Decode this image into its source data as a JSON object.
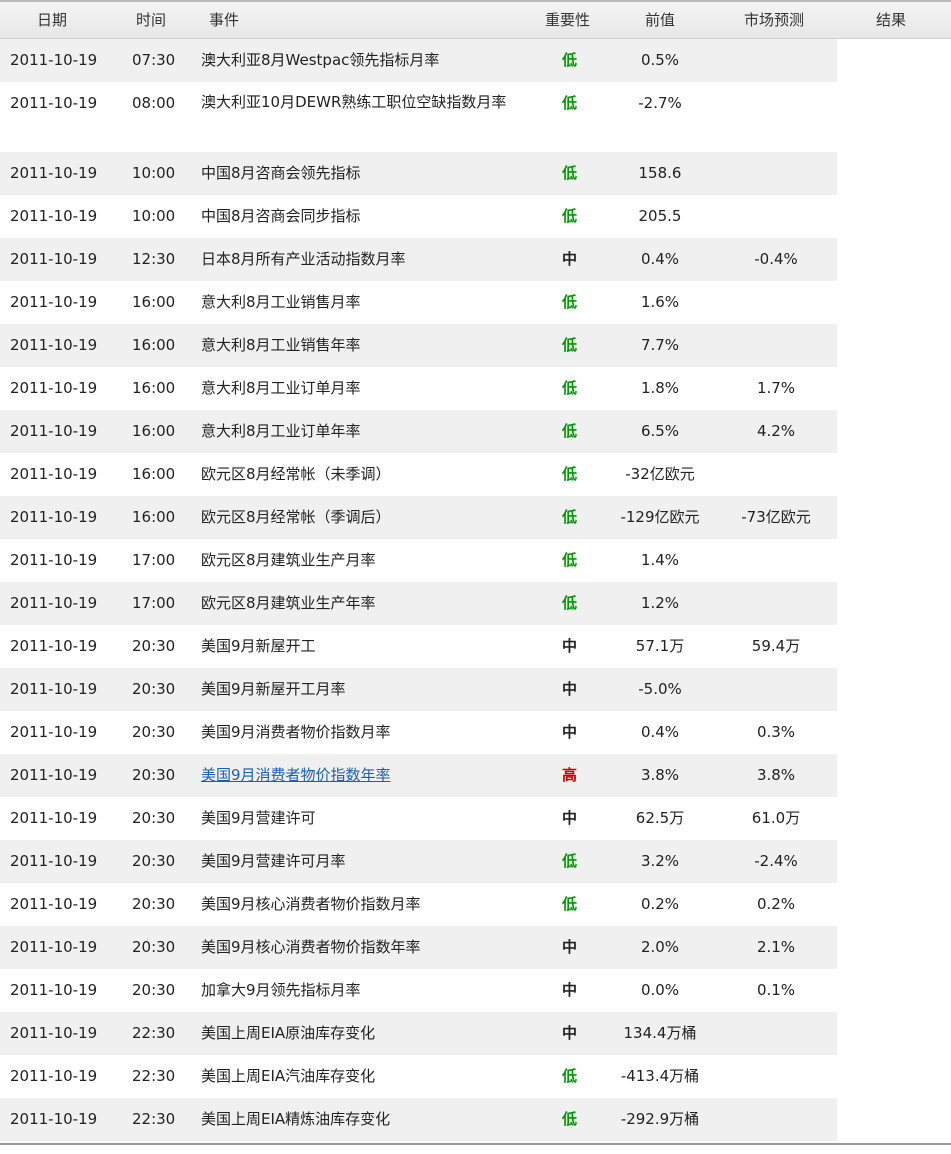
{
  "header": {
    "date": "日期",
    "time": "时间",
    "event": "事件",
    "importance": "重要性",
    "previous": "前值",
    "forecast": "市场预测",
    "result": "结果"
  },
  "colors": {
    "low": "#009900",
    "medium": "#000099",
    "high": "#cc0000",
    "row_alt": "#f0f0f0",
    "link": "#1a5fb4"
  },
  "rows": [
    {
      "date": "2011-10-19",
      "time": "07:30",
      "event": "澳大利亚8月Westpac领先指标月率",
      "importance": "低",
      "level": "low",
      "previous": "0.5%",
      "forecast": "",
      "result": ""
    },
    {
      "date": "2011-10-19",
      "time": "08:00",
      "event": "澳大利亚10月DEWR熟练工职位空缺指数月率",
      "importance": "低",
      "level": "low",
      "previous": "-2.7%",
      "forecast": "",
      "result": ""
    },
    {
      "date": "2011-10-19",
      "time": "10:00",
      "event": "中国8月咨商会领先指标",
      "importance": "低",
      "level": "low",
      "previous": "158.6",
      "forecast": "",
      "result": ""
    },
    {
      "date": "2011-10-19",
      "time": "10:00",
      "event": "中国8月咨商会同步指标",
      "importance": "低",
      "level": "low",
      "previous": "205.5",
      "forecast": "",
      "result": ""
    },
    {
      "date": "2011-10-19",
      "time": "12:30",
      "event": "日本8月所有产业活动指数月率",
      "importance": "中",
      "level": "medium",
      "previous": "0.4%",
      "forecast": "-0.4%",
      "result": ""
    },
    {
      "date": "2011-10-19",
      "time": "16:00",
      "event": "意大利8月工业销售月率",
      "importance": "低",
      "level": "low",
      "previous": "1.6%",
      "forecast": "",
      "result": ""
    },
    {
      "date": "2011-10-19",
      "time": "16:00",
      "event": "意大利8月工业销售年率",
      "importance": "低",
      "level": "low",
      "previous": "7.7%",
      "forecast": "",
      "result": ""
    },
    {
      "date": "2011-10-19",
      "time": "16:00",
      "event": "意大利8月工业订单月率",
      "importance": "低",
      "level": "low",
      "previous": "1.8%",
      "forecast": "1.7%",
      "result": ""
    },
    {
      "date": "2011-10-19",
      "time": "16:00",
      "event": "意大利8月工业订单年率",
      "importance": "低",
      "level": "low",
      "previous": "6.5%",
      "forecast": "4.2%",
      "result": ""
    },
    {
      "date": "2011-10-19",
      "time": "16:00",
      "event": "欧元区8月经常帐（未季调）",
      "importance": "低",
      "level": "low",
      "previous": "-32亿欧元",
      "forecast": "",
      "result": ""
    },
    {
      "date": "2011-10-19",
      "time": "16:00",
      "event": "欧元区8月经常帐（季调后）",
      "importance": "低",
      "level": "low",
      "previous": "-129亿欧元",
      "forecast": "-73亿欧元",
      "result": ""
    },
    {
      "date": "2011-10-19",
      "time": "17:00",
      "event": "欧元区8月建筑业生产月率",
      "importance": "低",
      "level": "low",
      "previous": "1.4%",
      "forecast": "",
      "result": ""
    },
    {
      "date": "2011-10-19",
      "time": "17:00",
      "event": "欧元区8月建筑业生产年率",
      "importance": "低",
      "level": "low",
      "previous": "1.2%",
      "forecast": "",
      "result": ""
    },
    {
      "date": "2011-10-19",
      "time": "20:30",
      "event": "美国9月新屋开工",
      "importance": "中",
      "level": "medium",
      "previous": "57.1万",
      "forecast": "59.4万",
      "result": ""
    },
    {
      "date": "2011-10-19",
      "time": "20:30",
      "event": "美国9月新屋开工月率",
      "importance": "中",
      "level": "medium",
      "previous": "-5.0%",
      "forecast": "",
      "result": ""
    },
    {
      "date": "2011-10-19",
      "time": "20:30",
      "event": "美国9月消费者物价指数月率",
      "importance": "中",
      "level": "medium",
      "previous": "0.4%",
      "forecast": "0.3%",
      "result": ""
    },
    {
      "date": "2011-10-19",
      "time": "20:30",
      "event": "美国9月消费者物价指数年率",
      "importance": "高",
      "level": "high",
      "previous": "3.8%",
      "forecast": "3.8%",
      "result": "",
      "link": true
    },
    {
      "date": "2011-10-19",
      "time": "20:30",
      "event": "美国9月营建许可",
      "importance": "中",
      "level": "medium",
      "previous": "62.5万",
      "forecast": "61.0万",
      "result": ""
    },
    {
      "date": "2011-10-19",
      "time": "20:30",
      "event": "美国9月营建许可月率",
      "importance": "低",
      "level": "low",
      "previous": "3.2%",
      "forecast": "-2.4%",
      "result": ""
    },
    {
      "date": "2011-10-19",
      "time": "20:30",
      "event": "美国9月核心消费者物价指数月率",
      "importance": "低",
      "level": "low",
      "previous": "0.2%",
      "forecast": "0.2%",
      "result": ""
    },
    {
      "date": "2011-10-19",
      "time": "20:30",
      "event": "美国9月核心消费者物价指数年率",
      "importance": "中",
      "level": "medium",
      "previous": "2.0%",
      "forecast": "2.1%",
      "result": ""
    },
    {
      "date": "2011-10-19",
      "time": "20:30",
      "event": "加拿大9月领先指标月率",
      "importance": "中",
      "level": "medium",
      "previous": "0.0%",
      "forecast": "0.1%",
      "result": ""
    },
    {
      "date": "2011-10-19",
      "time": "22:30",
      "event": "美国上周EIA原油库存变化",
      "importance": "中",
      "level": "medium",
      "previous": "134.4万桶",
      "forecast": "",
      "result": ""
    },
    {
      "date": "2011-10-19",
      "time": "22:30",
      "event": "美国上周EIA汽油库存变化",
      "importance": "低",
      "level": "low",
      "previous": "-413.4万桶",
      "forecast": "",
      "result": ""
    },
    {
      "date": "2011-10-19",
      "time": "22:30",
      "event": "美国上周EIA精炼油库存变化",
      "importance": "低",
      "level": "low",
      "previous": "-292.9万桶",
      "forecast": "",
      "result": ""
    }
  ]
}
